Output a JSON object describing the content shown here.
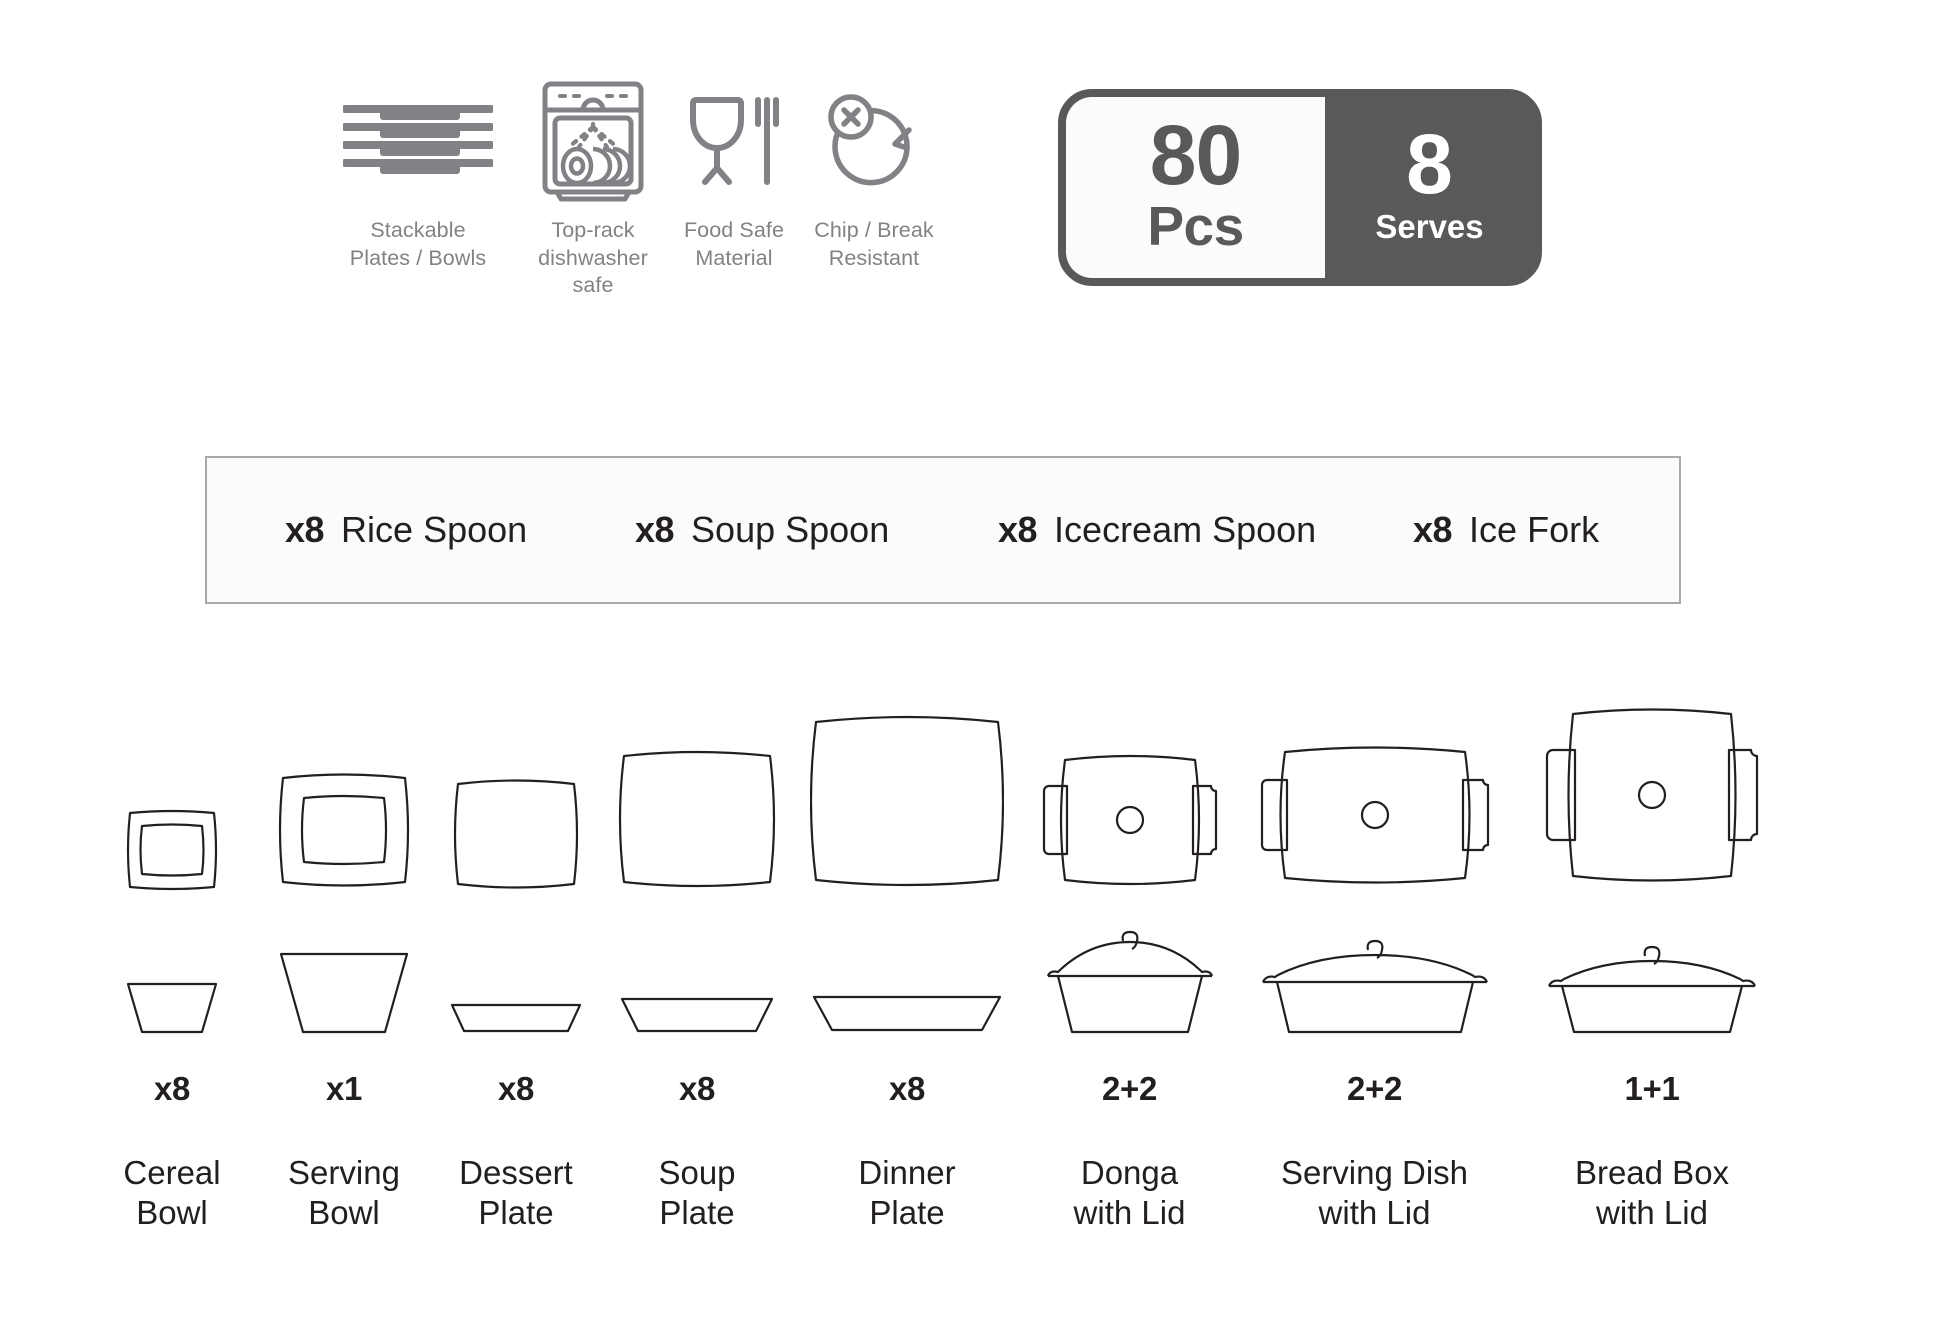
{
  "features": [
    {
      "icon": "stacked-plates-icon",
      "caption": "Stackable\nPlates / Bowls"
    },
    {
      "icon": "dishwasher-icon",
      "caption": "Top-rack\ndishwasher safe"
    },
    {
      "icon": "glass-fork-icon",
      "caption": "Food Safe\nMaterial"
    },
    {
      "icon": "chip-break-resistant-icon",
      "caption": "Chip / Break\nResistant"
    }
  ],
  "badge": {
    "pieces_number": "80",
    "pieces_label": "Pcs",
    "serves_number": "8",
    "serves_label": "Serves",
    "dark_color": "#58595b",
    "light_color": "#fbfbfb"
  },
  "cutlery": [
    {
      "qty": "x8",
      "name": "Rice Spoon"
    },
    {
      "qty": "x8",
      "name": "Soup Spoon"
    },
    {
      "qty": "x8",
      "name": "Icecream Spoon"
    },
    {
      "qty": "x8",
      "name": "Ice Fork"
    }
  ],
  "products": [
    {
      "qty": "x8",
      "label": "Cereal\nBowl",
      "icon": "cereal-bowl-icon"
    },
    {
      "qty": "x1",
      "label": "Serving\nBowl",
      "icon": "serving-bowl-icon"
    },
    {
      "qty": "x8",
      "label": "Dessert\nPlate",
      "icon": "dessert-plate-icon"
    },
    {
      "qty": "x8",
      "label": "Soup\nPlate",
      "icon": "soup-plate-icon"
    },
    {
      "qty": "x8",
      "label": "Dinner\nPlate",
      "icon": "dinner-plate-icon"
    },
    {
      "qty": "2+2",
      "label": "Donga\nwith Lid",
      "icon": "donga-with-lid-icon"
    },
    {
      "qty": "2+2",
      "label": "Serving Dish\nwith Lid",
      "icon": "serving-dish-with-lid-icon"
    },
    {
      "qty": "1+1",
      "label": "Bread Box\nwith Lid",
      "icon": "bread-box-with-lid-icon"
    }
  ],
  "colors": {
    "icon_gray": "#808285",
    "line_black": "#231f20",
    "bar_border": "#a7a9ac",
    "bar_fill": "#fbfbfb"
  }
}
